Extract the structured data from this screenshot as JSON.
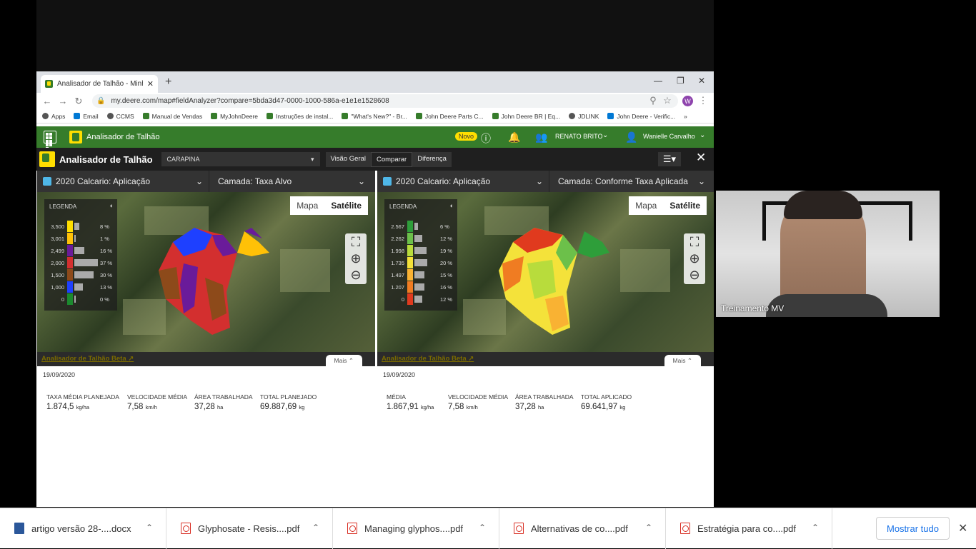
{
  "browser": {
    "tab_title": "Analisador de Talhão - Minhas O",
    "url": "my.deere.com/map#fieldAnalyzer?compare=5bda3d47-0000-1000-586a-e1e1e1528608",
    "avatar_letter": "W",
    "bookmarks": [
      "Apps",
      "Email",
      "CCMS",
      "Manual de Vendas",
      "MyJohnDeere",
      "Instruções de instal...",
      "\"What's New?\" - Br...",
      "John Deere Parts C...",
      "John Deere BR | Eq...",
      "JDLINK",
      "John Deere - Verific..."
    ]
  },
  "header": {
    "app_title": "Analisador de Talhão",
    "novo_badge": "Novo",
    "org_name": "RENATO BRITO",
    "user_name": "Wanielle Carvalho"
  },
  "toolbar": {
    "title": "Analisador de Talhão",
    "field": "CARAPINA",
    "views": [
      "Visão Geral",
      "Comparar",
      "Diferença"
    ]
  },
  "panels": [
    {
      "operation": "2020 Calcario: Aplicação",
      "layer": "Camada: Taxa Alvo",
      "map_mode": [
        "Mapa",
        "Satélite"
      ],
      "legend_title": "LEGENDA",
      "legend": [
        {
          "value": "3,500",
          "pct": "8 %",
          "color": "#ffde00",
          "frac": 0.08
        },
        {
          "value": "3,001",
          "pct": "1 %",
          "color": "#ffc107",
          "frac": 0.01
        },
        {
          "value": "2,499",
          "pct": "16 %",
          "color": "#6a1b9a",
          "frac": 0.16
        },
        {
          "value": "2,000",
          "pct": "37 %",
          "color": "#d32f2f",
          "frac": 0.37
        },
        {
          "value": "1,500",
          "pct": "30 %",
          "color": "#8d4a1a",
          "frac": 0.3
        },
        {
          "value": "1,000",
          "pct": "13 %",
          "color": "#1e40ff",
          "frac": 0.13
        },
        {
          "value": "0",
          "pct": "0 %",
          "color": "#1b8a2e",
          "frac": 0.0
        }
      ],
      "link": "Analisador de Talhão Beta",
      "more": "Mais",
      "date": "19/09/2020",
      "stats": [
        {
          "label": "TAXA MÉDIA PLANEJADA",
          "value": "1.874,5",
          "unit": "kg/ha"
        },
        {
          "label": "VELOCIDADE MÉDIA",
          "value": "7,58",
          "unit": "km/h"
        },
        {
          "label": "ÁREA TRABALHADA",
          "value": "37,28",
          "unit": "ha"
        },
        {
          "label": "TOTAL PLANEJADO",
          "value": "69.887,69",
          "unit": "kg"
        }
      ]
    },
    {
      "operation": "2020 Calcario: Aplicação",
      "layer": "Camada: Conforme Taxa Aplicada",
      "map_mode": [
        "Mapa",
        "Satélite"
      ],
      "legend_title": "LEGENDA",
      "legend": [
        {
          "value": "2.567",
          "pct": "6 %",
          "color": "#2e9e3a",
          "frac": 0.06
        },
        {
          "value": "2.262",
          "pct": "12 %",
          "color": "#6cc04a",
          "frac": 0.12
        },
        {
          "value": "1.998",
          "pct": "19 %",
          "color": "#b8dc3c",
          "frac": 0.19
        },
        {
          "value": "1.735",
          "pct": "20 %",
          "color": "#f4e23a",
          "frac": 0.2
        },
        {
          "value": "1.497",
          "pct": "15 %",
          "color": "#f9b233",
          "frac": 0.15
        },
        {
          "value": "1.207",
          "pct": "16 %",
          "color": "#f07c22",
          "frac": 0.16
        },
        {
          "value": "0",
          "pct": "12 %",
          "color": "#e03a1e",
          "frac": 0.12
        }
      ],
      "link": "Analisador de Talhão Beta",
      "more": "Mais",
      "date": "19/09/2020",
      "stats": [
        {
          "label": "MÉDIA",
          "value": "1.867,91",
          "unit": "kg/ha"
        },
        {
          "label": "VELOCIDADE MÉDIA",
          "value": "7,58",
          "unit": "km/h"
        },
        {
          "label": "ÁREA TRABALHADA",
          "value": "37,28",
          "unit": "ha"
        },
        {
          "label": "TOTAL APLICADO",
          "value": "69.641,97",
          "unit": "kg"
        }
      ]
    }
  ],
  "webcam": {
    "label": "Treinamento MV"
  },
  "downloads": {
    "items": [
      "artigo versão 28-....docx",
      "Glyphosate - Resis....pdf",
      "Managing glyphos....pdf",
      "Alternativas de co....pdf",
      "Estratégia para co....pdf"
    ],
    "show_all": "Mostrar tudo"
  }
}
